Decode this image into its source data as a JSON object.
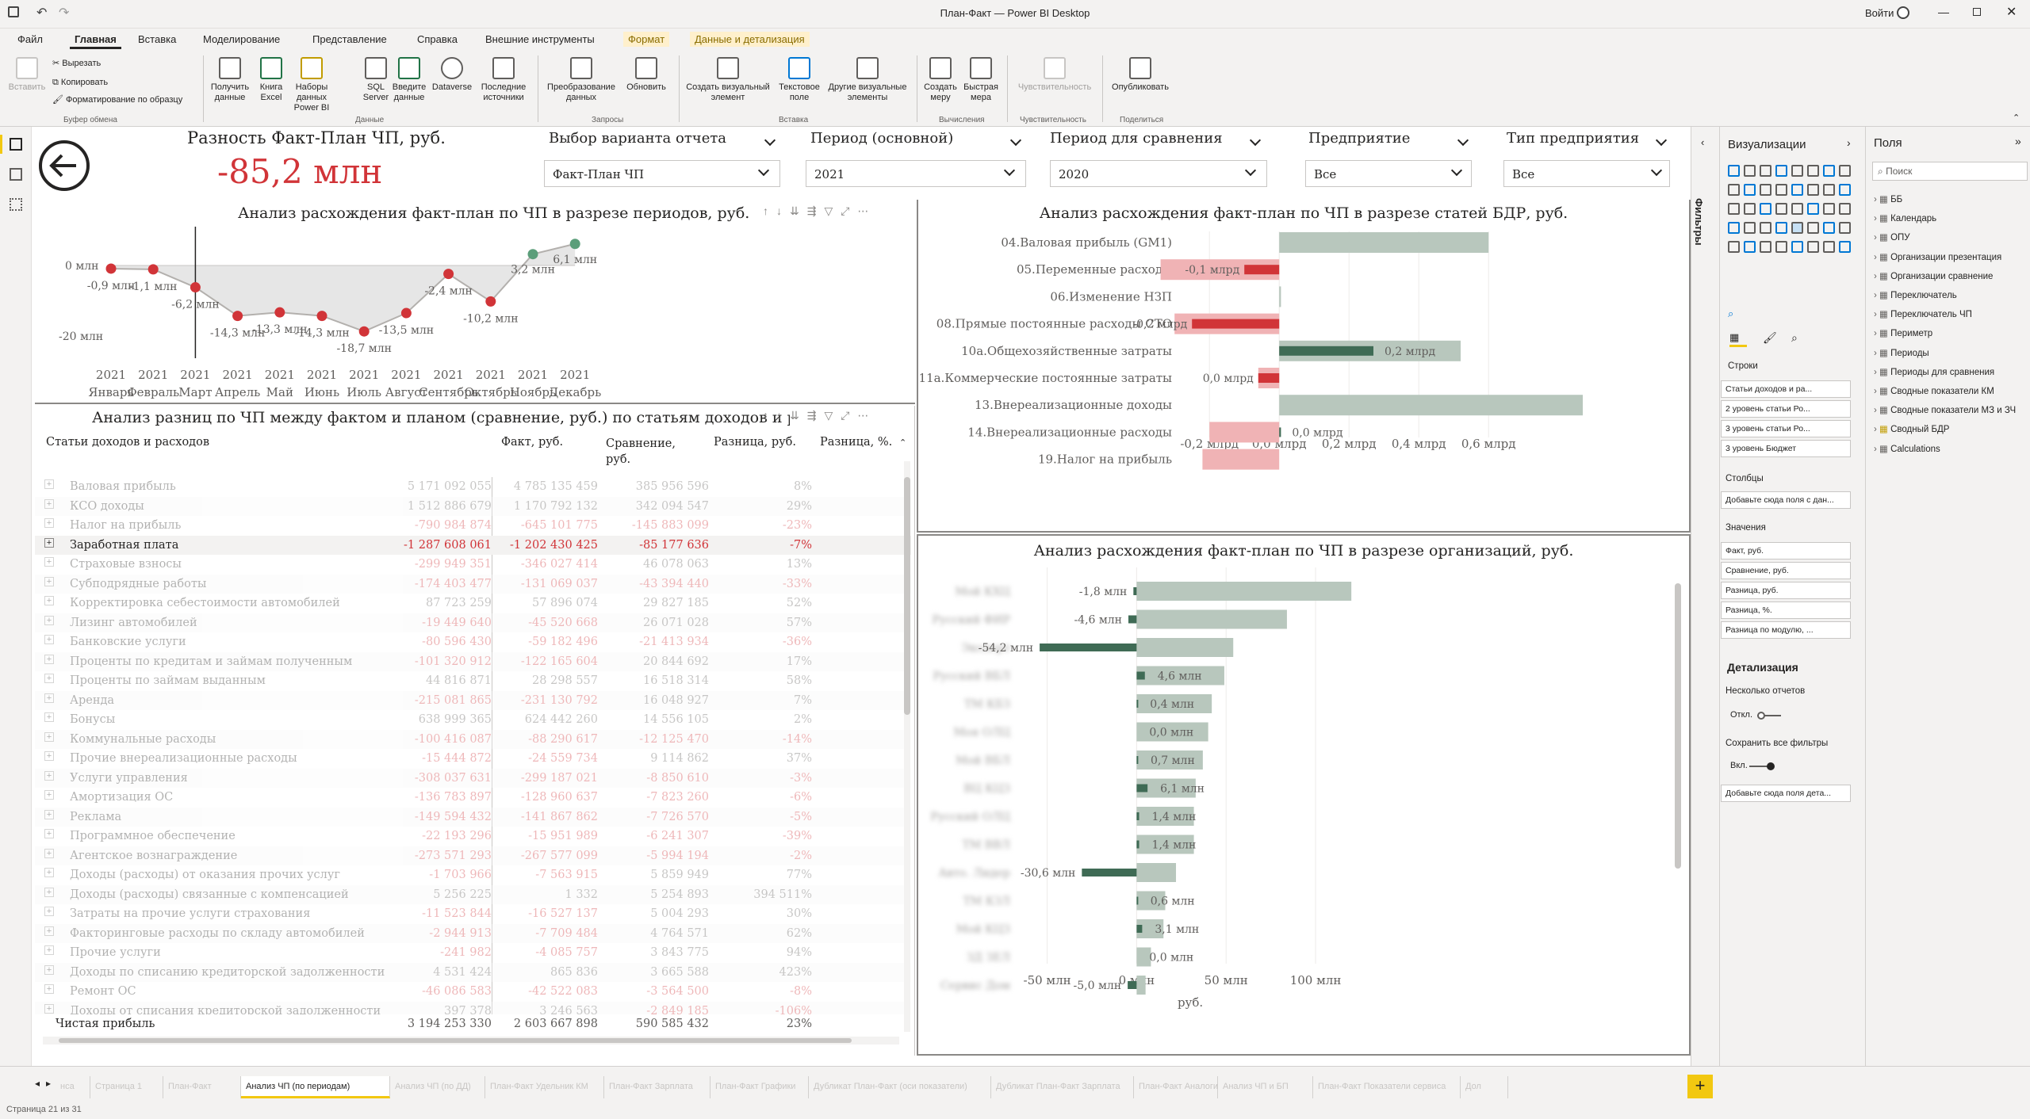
{
  "window": {
    "title": "План-Факт — Power BI Desktop",
    "signin": "Войти"
  },
  "menu_tabs": [
    "Файл",
    "Главная",
    "Вставка",
    "Моделирование",
    "Представление",
    "Справка",
    "Внешние инструменты",
    "Формат",
    "Данные и детализация"
  ],
  "ribbon": {
    "clipboard": {
      "paste": "Вставить",
      "cut": "Вырезать",
      "copy": "Копировать",
      "format_painter": "Форматирование по образцу",
      "group": "Буфер обмена"
    },
    "data": {
      "get_data": "Получить данные",
      "excel": "Книга Excel",
      "datasets": "Наборы данных Power BI",
      "sql": "SQL Server",
      "enter": "Введите данные",
      "dataverse": "Dataverse",
      "recent": "Последние источники",
      "group": "Данные"
    },
    "queries": {
      "transform": "Преобразование данных",
      "refresh": "Обновить",
      "group": "Запросы"
    },
    "insert": {
      "new_visual": "Создать визуальный элемент",
      "text_box": "Текстовое поле",
      "more_visuals": "Другие визуальные элементы",
      "group": "Вставка"
    },
    "calc": {
      "new_measure": "Создать меру",
      "quick_measure": "Быстрая мера",
      "group": "Вычисления"
    },
    "sensitivity": {
      "label": "Чувствительность",
      "group": "Чувствительность"
    },
    "share": {
      "publish": "Опубликовать",
      "group": "Поделиться"
    }
  },
  "kpi": {
    "title": "Разность Факт-План ЧП, руб.",
    "value": "-85,2 млн"
  },
  "slicers": [
    {
      "title": "Выбор варианта отчета",
      "value": "Факт-План ЧП"
    },
    {
      "title": "Период (основной)",
      "value": "2021"
    },
    {
      "title": "Период для сравнения",
      "value": "2020"
    },
    {
      "title": "Предприятие",
      "value": "Все"
    },
    {
      "title": "Тип предприятия",
      "value": "Все"
    }
  ],
  "line_chart": {
    "title": "Анализ расхождения факт-план по ЧП в разрезе периодов, руб.",
    "y_ticks": [
      "0 млн",
      "-20 млн"
    ],
    "chart_data": {
      "type": "line",
      "categories": [
        "2021 Январь",
        "2021 Февраль",
        "2021 Март",
        "2021 Апрель",
        "2021 Май",
        "2021 Июнь",
        "2021 Июль",
        "2021 Август",
        "2021 Сентябрь",
        "2021 Октябрь",
        "2021 Ноябрь",
        "2021 Декабрь"
      ],
      "values": [
        -0.9,
        -1.1,
        -6.2,
        -14.3,
        -13.3,
        -14.3,
        -18.7,
        -13.5,
        -2.4,
        -10.2,
        3.2,
        6.1
      ],
      "labels": [
        "-0,9 млн",
        "-1,1 млн",
        "-6,2 млн",
        "-14,3 млн",
        "-13,3 млн",
        "-14,3 млн",
        "-18,7 млн",
        "-13,5 млн",
        "-2,4 млн",
        "-10,2 млн",
        "3,2 млн",
        "6,1 млн"
      ],
      "x_years": [
        "2021",
        "2021",
        "2021",
        "2021",
        "2021",
        "2021",
        "2021",
        "2021",
        "2021",
        "2021",
        "2021",
        "2021"
      ],
      "x_months": [
        "Январь",
        "Февраль",
        "Март",
        "Апрель",
        "Май",
        "Июнь",
        "Июль",
        "Август",
        "Сентябрь",
        "Октябрь",
        "Ноябрь",
        "Декабрь"
      ],
      "ylim": [
        -20,
        6.5
      ],
      "colors": {
        "neg": "#d13438",
        "pos": "#5b9e7a",
        "line": "#b3b0ad",
        "area": "#e6e6e6"
      }
    }
  },
  "bdr_chart": {
    "title": "Анализ расхождения факт-план по ЧП в разрезе статей БДР, руб.",
    "chart_data": {
      "type": "bar",
      "categories": [
        "04.Валовая прибыль (GM1)",
        "05.Переменные расходы",
        "06.Изменение НЗП",
        "08.Прямые постоянные расходы СТО",
        "10а.Общехозяйственные затраты",
        "11а.Коммерческие постоянные затраты",
        "13.Внереализационные доходы",
        "14.Внереализационные расходы",
        "19.Налог на прибыль"
      ],
      "plan": [
        0.6,
        -0.34,
        0.005,
        -0.3,
        0.52,
        -0.06,
        0.87,
        -0.2,
        -0.22
      ],
      "diff": [
        0,
        -0.1,
        0,
        -0.25,
        0.27,
        -0.06,
        0,
        0.005,
        0
      ],
      "labels": [
        "",
        "-0,1 млрд",
        "",
        "-0,2 млрд",
        "0,2 млрд",
        "0,0 млрд",
        "",
        "0,0 млрд",
        ""
      ],
      "x_ticks": [
        "-0,2 млрд",
        "0,0 млрд",
        "0,2 млрд",
        "0,4 млрд",
        "0,6 млрд"
      ],
      "xlim": [
        -0.33,
        0.92
      ]
    }
  },
  "org_chart": {
    "title": "Анализ расхождения факт-план по ЧП в разрезе организаций, руб.",
    "xlabel": "руб.",
    "chart_data": {
      "type": "bar",
      "categories": [
        "Мой КХЦ",
        "Русский ФИР",
        "Эксперт",
        "Русский ВБЛ",
        "ТМ КБЗ",
        "Моя ОЛЦ",
        "Мой ВБЛ",
        "ВЦ КЦЗ",
        "Русский ОЛЦ",
        "ТМ ВВЛ",
        "Авто. Лидер",
        "ТМ КЗЛ",
        "Мой КЦЗ",
        "ЗД ЗЕЛ",
        "Сервис Дом"
      ],
      "plan": [
        120.0,
        84.0,
        54.0,
        49.0,
        42.0,
        40.0,
        37.0,
        33.0,
        32.0,
        32.0,
        22.0,
        16.0,
        15.0,
        8.0,
        5.0
      ],
      "diff": [
        -1.8,
        -4.6,
        -54.2,
        4.6,
        0.4,
        0.0,
        0.7,
        6.1,
        1.4,
        1.4,
        -30.6,
        0.6,
        3.1,
        0.0,
        -5.0
      ],
      "labels": [
        "-1,8 млн",
        "-4,6 млн",
        "-54,2 млн",
        "4,6 млн",
        "0,4 млн",
        "0,0 млн",
        "0,7 млн",
        "6,1 млн",
        "1,4 млн",
        "1,4 млн",
        "-30,6 млн",
        "0,6 млн",
        "3,1 млн",
        "0,0 млн",
        "-5,0 млн"
      ],
      "x_ticks": [
        "-50 млн",
        "0 млн",
        "50 млн",
        "100 млн"
      ],
      "xlim": [
        -60,
        135
      ]
    }
  },
  "matrix": {
    "title": "Анализ разниц по ЧП между фактом и планом (сравнение, руб.) по статьям доходов и расходов",
    "headers": [
      "Статьи доходов и расходов",
      "Факт, руб.",
      "Сравнение, руб.",
      "Разница, руб.",
      "Разница, %."
    ],
    "rows": [
      [
        "Валовая прибыль",
        "5 171 092 055",
        "4 785 135 459",
        "385 956 596",
        "8%"
      ],
      [
        "КСО доходы",
        "1 512 886 679",
        "1 170 792 132",
        "342 094 547",
        "29%"
      ],
      [
        "Налог на прибыль",
        "-790 984 874",
        "-645 101 775",
        "-145 883 099",
        "-23%"
      ],
      [
        "Заработная плата",
        "-1 287 608 061",
        "-1 202 430 425",
        "-85 177 636",
        "-7%"
      ],
      [
        "Страховые взносы",
        "-299 949 351",
        "-346 027 414",
        "46 078 063",
        "13%"
      ],
      [
        "Субподрядные работы",
        "-174 403 477",
        "-131 069 037",
        "-43 394 440",
        "-33%"
      ],
      [
        "Корректировка себестоимости автомобилей",
        "87 723 259",
        "57 896 074",
        "29 827 185",
        "52%"
      ],
      [
        "Лизинг автомобилей",
        "-19 449 640",
        "-45 520 668",
        "26 071 028",
        "57%"
      ],
      [
        "Банковские услуги",
        "-80 596 430",
        "-59 182 496",
        "-21 413 934",
        "-36%"
      ],
      [
        "Проценты по кредитам и займам полученным",
        "-101 320 912",
        "-122 165 604",
        "20 844 692",
        "17%"
      ],
      [
        "Проценты по займам выданным",
        "44 816 871",
        "28 298 557",
        "16 518 314",
        "58%"
      ],
      [
        "Аренда",
        "-215 081 865",
        "-231 130 792",
        "16 048 927",
        "7%"
      ],
      [
        "Бонусы",
        "638 999 365",
        "624 442 260",
        "14 556 105",
        "2%"
      ],
      [
        "Коммунальные расходы",
        "-100 416 087",
        "-88 290 617",
        "-12 125 470",
        "-14%"
      ],
      [
        "Прочие внереализационные расходы",
        "-15 444 872",
        "-24 559 734",
        "9 114 862",
        "37%"
      ],
      [
        "Услуги управления",
        "-308 037 631",
        "-299 187 021",
        "-8 850 610",
        "-3%"
      ],
      [
        "Амортизация ОС",
        "-136 783 897",
        "-128 960 637",
        "-7 823 260",
        "-6%"
      ],
      [
        "Реклама",
        "-149 594 432",
        "-141 867 862",
        "-7 726 570",
        "-5%"
      ],
      [
        "Программное обеспечение",
        "-22 193 296",
        "-15 951 989",
        "-6 241 307",
        "-39%"
      ],
      [
        "Агентское вознаграждение",
        "-273 571 293",
        "-267 577 099",
        "-5 994 194",
        "-2%"
      ],
      [
        "Доходы (расходы) от оказания прочих услуг",
        "-1 703 966",
        "-7 563 915",
        "5 859 949",
        "77%"
      ],
      [
        "Доходы (расходы) связанные с компенсацией",
        "5 256 225",
        "1 332",
        "5 254 893",
        "394 511%"
      ],
      [
        "Затраты на прочие услуги страхования",
        "-11 523 844",
        "-16 527 137",
        "5 004 293",
        "30%"
      ],
      [
        "Факторинговые расходы по складу автомобилей",
        "-2 944 913",
        "-7 709 484",
        "4 764 571",
        "62%"
      ],
      [
        "Прочие услуги",
        "-241 982",
        "-4 085 757",
        "3 843 775",
        "94%"
      ],
      [
        "Доходы по списанию кредиторской задолженности",
        "4 531 424",
        "865 836",
        "3 665 588",
        "423%"
      ],
      [
        "Ремонт ОС",
        "-46 086 583",
        "-42 522 083",
        "-3 564 500",
        "-8%"
      ],
      [
        "Доходы от списания кредиторской задолженности",
        "397 378",
        "3 246 563",
        "-2 849 185",
        "-106%"
      ]
    ],
    "total": [
      "Чистая прибыль",
      "3 194 253 330",
      "2 603 667 898",
      "590 585 432",
      "23%"
    ]
  },
  "panes": {
    "filters": "Фильтры",
    "viz_title": "Визуализации",
    "fields_title": "Поля",
    "search_placeholder": "Поиск",
    "rows_label": "Строки",
    "row_wells": [
      "Статьи доходов и ра...",
      "2 уровень статьи Ро...",
      "3 уровень статьи Ро...",
      "3 уровень Бюджет"
    ],
    "columns_label": "Столбцы",
    "columns_add": "Добавьте сюда поля с дан...",
    "values_label": "Значения",
    "value_wells": [
      "Факт, руб.",
      "Сравнение, руб.",
      "Разница, руб.",
      "Разница, %.",
      "Разница по модулю, ..."
    ],
    "drill_title": "Детализация",
    "multi_reports": "Несколько отчетов",
    "off": "Откл.",
    "keep_filters": "Сохранить все фильтры",
    "on": "Вкл.",
    "drill_add": "Добавьте сюда поля дета...",
    "fields": [
      "ББ",
      "Календарь",
      "ОПУ",
      "Организации презентация",
      "Организации сравнение",
      "Переключатель",
      "Переключатель ЧП",
      "Периметр",
      "Периоды",
      "Периоды для сравнения",
      "Сводные показатели КМ",
      "Сводные показатели МЗ и ЗЧ",
      "Сводный БДР",
      "Calculations"
    ]
  },
  "page_tabs": [
    "нса",
    "Страница 1",
    "План-Факт",
    "Анализ ЧП (по периодам)",
    "Анализ ЧП (по ДД)",
    "План-Факт Удельник КМ",
    "План-Факт Зарплата",
    "План-Факт Графики",
    "Дубликат План-Факт (оси показатели)",
    "Дубликат План-Факт Зарплата",
    "План-Факт Аналоги",
    "Анализ ЧП и БП",
    "План-Факт Показатели сервиса",
    "Дол"
  ],
  "status": "Страница 21 из 31"
}
